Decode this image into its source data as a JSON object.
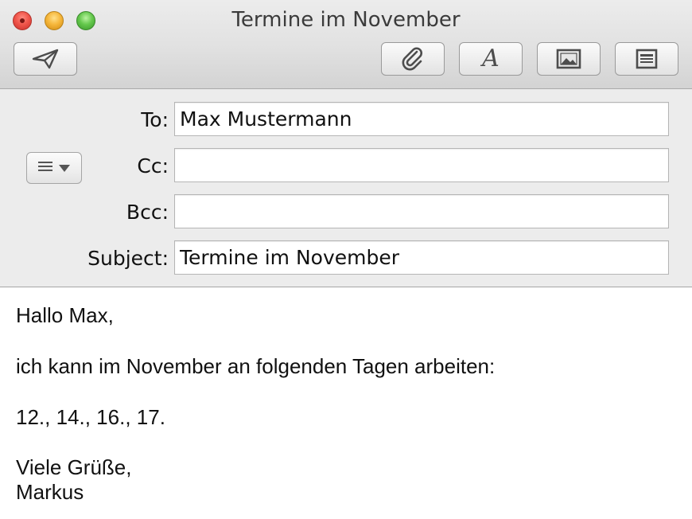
{
  "window": {
    "title": "Termine im November"
  },
  "toolbar": {
    "send": {
      "icon": "paper-plane-icon"
    },
    "attach": {
      "icon": "paperclip-icon"
    },
    "fonts": {
      "glyph": "A",
      "icon": "font-icon"
    },
    "photo": {
      "icon": "photo-browser-icon"
    },
    "stationery": {
      "icon": "stationery-icon"
    }
  },
  "header": {
    "to": {
      "label": "To:",
      "value": "Max Mustermann"
    },
    "cc": {
      "label": "Cc:",
      "value": ""
    },
    "bcc": {
      "label": "Bcc:",
      "value": ""
    },
    "subject": {
      "label": "Subject:",
      "value": "Termine im November"
    }
  },
  "body": {
    "greeting": "Hallo Max,",
    "line1": "ich kann im November an folgenden Tagen arbeiten:",
    "dates": "12., 14., 16., 17.",
    "closing": "Viele Grüße,",
    "signature": "Markus"
  }
}
